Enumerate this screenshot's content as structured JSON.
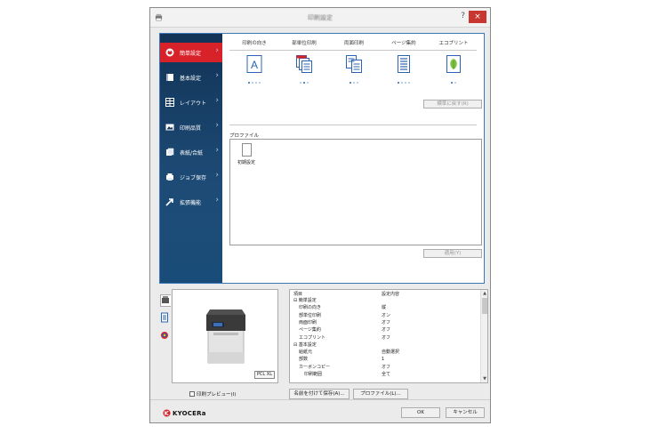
{
  "window": {
    "title": "印刷設定",
    "help": "?",
    "close": "×"
  },
  "sidebar": {
    "items": [
      {
        "label": "簡単設定",
        "icon": "quick-setup-icon",
        "active": true
      },
      {
        "label": "基本設定",
        "icon": "basic-icon"
      },
      {
        "label": "レイアウト",
        "icon": "layout-icon"
      },
      {
        "label": "印刷品質",
        "icon": "quality-icon"
      },
      {
        "label": "表紙/合紙",
        "icon": "cover-icon"
      },
      {
        "label": "ジョブ保存",
        "icon": "job-store-icon"
      },
      {
        "label": "拡張機能",
        "icon": "advanced-icon"
      }
    ]
  },
  "quick": {
    "columns": [
      {
        "label": "印刷の向き",
        "icon": "orientation-icon"
      },
      {
        "label": "部単位印刷",
        "icon": "collate-icon"
      },
      {
        "label": "両面印刷",
        "icon": "duplex-icon"
      },
      {
        "label": "ページ集約",
        "icon": "multi-page-icon"
      },
      {
        "label": "エコプリント",
        "icon": "ecoprint-icon"
      }
    ],
    "orientation_glyph": "A",
    "reset_label": "標準に戻す(R)"
  },
  "profile": {
    "label": "プロファイル",
    "items": [
      {
        "label": "初期設定"
      }
    ],
    "apply_label": "適用(Y)"
  },
  "preview": {
    "badge": "PCL XL"
  },
  "settings": {
    "headers": {
      "item": "項目",
      "value": "設定内容"
    },
    "rows": [
      {
        "k": "⊟ 簡単設定",
        "v": "",
        "indent": 0
      },
      {
        "k": "印刷の向き",
        "v": "縦",
        "indent": 1
      },
      {
        "k": "部単位印刷",
        "v": "オン",
        "indent": 1
      },
      {
        "k": "両面印刷",
        "v": "オフ",
        "indent": 1
      },
      {
        "k": "ページ集約",
        "v": "オフ",
        "indent": 1
      },
      {
        "k": "エコプリント",
        "v": "オフ",
        "indent": 1
      },
      {
        "k": "⊟ 基本設定",
        "v": "",
        "indent": 0
      },
      {
        "k": "給紙元",
        "v": "自動選択",
        "indent": 1
      },
      {
        "k": "部数",
        "v": "1",
        "indent": 1
      },
      {
        "k": "カーボンコピー",
        "v": "オフ",
        "indent": 1
      },
      {
        "k": "印刷範囲",
        "v": "全て",
        "indent": 2
      }
    ]
  },
  "footer": {
    "print_preview_label": "印刷プレビュー(I)",
    "save_as_label": "名前を付けて保存(A)...",
    "profile_label": "プロファイル(L)...",
    "ok_label": "OK",
    "cancel_label": "キャンセル",
    "logo_text": "KYOCERa"
  },
  "colors": {
    "accent": "#d8222a",
    "sidebar": "#1b3a5d",
    "frame": "#3a76b8"
  }
}
